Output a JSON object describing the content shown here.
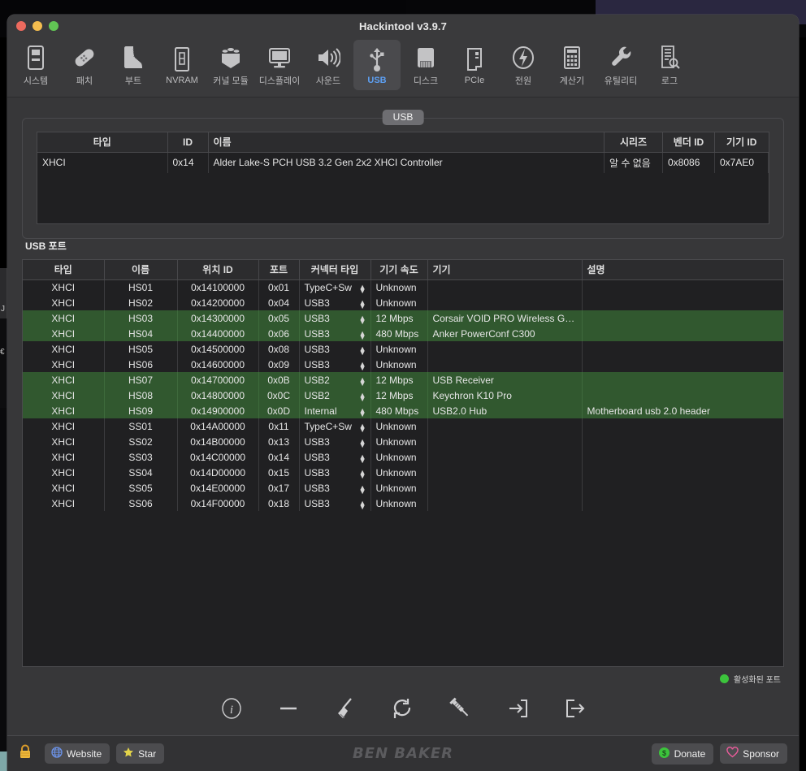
{
  "window": {
    "title": "Hackintool v3.9.7",
    "traffic_lights": [
      "close",
      "minimize",
      "zoom"
    ]
  },
  "toolbar": {
    "items": [
      {
        "label": "시스템",
        "icon": "computer-icon",
        "active": false
      },
      {
        "label": "패치",
        "icon": "bandage-icon",
        "active": false
      },
      {
        "label": "부트",
        "icon": "boot-icon",
        "active": false
      },
      {
        "label": "NVRAM",
        "icon": "memory-icon",
        "active": false
      },
      {
        "label": "커널 모듈",
        "icon": "kext-box-icon",
        "active": false
      },
      {
        "label": "디스플레이",
        "icon": "display-icon",
        "active": false
      },
      {
        "label": "사운드",
        "icon": "speaker-icon",
        "active": false
      },
      {
        "label": "USB",
        "icon": "usb-icon",
        "active": true
      },
      {
        "label": "디스크",
        "icon": "disk-icon",
        "active": false
      },
      {
        "label": "PCIe",
        "icon": "pcie-card-icon",
        "active": false
      },
      {
        "label": "전원",
        "icon": "power-bolt-icon",
        "active": false
      },
      {
        "label": "계산기",
        "icon": "calculator-icon",
        "active": false
      },
      {
        "label": "유틸리티",
        "icon": "wrench-icon",
        "active": false
      },
      {
        "label": "로그",
        "icon": "log-search-icon",
        "active": false
      }
    ]
  },
  "usb_group": {
    "tab_label": "USB",
    "controller_table": {
      "columns": [
        "타입",
        "ID",
        "이름",
        "시리즈",
        "벤더 ID",
        "기기 ID"
      ],
      "rows": [
        {
          "type": "XHCI",
          "id": "0x14",
          "name": "Alder Lake-S PCH USB 3.2 Gen 2x2 XHCI Controller",
          "series": "알 수 없음",
          "vendor_id": "0x8086",
          "device_id": "0x7AE0"
        }
      ]
    }
  },
  "ports_section": {
    "label": "USB 포트",
    "columns": [
      "타입",
      "이름",
      "위치 ID",
      "포트",
      "커넥터 타입",
      "기기 속도",
      "기기",
      "설명"
    ],
    "rows": [
      {
        "type": "XHCI",
        "name": "HS01",
        "location_id": "0x14100000",
        "port": "0x01",
        "connector": "TypeC+Sw",
        "speed": "Unknown",
        "device": "",
        "comment": "",
        "active": false
      },
      {
        "type": "XHCI",
        "name": "HS02",
        "location_id": "0x14200000",
        "port": "0x04",
        "connector": "USB3",
        "speed": "Unknown",
        "device": "",
        "comment": "",
        "active": false
      },
      {
        "type": "XHCI",
        "name": "HS03",
        "location_id": "0x14300000",
        "port": "0x05",
        "connector": "USB3",
        "speed": "12 Mbps",
        "device": "Corsair VOID PRO Wireless Ga…",
        "comment": "",
        "active": true
      },
      {
        "type": "XHCI",
        "name": "HS04",
        "location_id": "0x14400000",
        "port": "0x06",
        "connector": "USB3",
        "speed": "480 Mbps",
        "device": "Anker PowerConf C300",
        "comment": "",
        "active": true
      },
      {
        "type": "XHCI",
        "name": "HS05",
        "location_id": "0x14500000",
        "port": "0x08",
        "connector": "USB3",
        "speed": "Unknown",
        "device": "",
        "comment": "",
        "active": false
      },
      {
        "type": "XHCI",
        "name": "HS06",
        "location_id": "0x14600000",
        "port": "0x09",
        "connector": "USB3",
        "speed": "Unknown",
        "device": "",
        "comment": "",
        "active": false
      },
      {
        "type": "XHCI",
        "name": "HS07",
        "location_id": "0x14700000",
        "port": "0x0B",
        "connector": "USB2",
        "speed": "12 Mbps",
        "device": "USB Receiver",
        "comment": "",
        "active": true
      },
      {
        "type": "XHCI",
        "name": "HS08",
        "location_id": "0x14800000",
        "port": "0x0C",
        "connector": "USB2",
        "speed": "12 Mbps",
        "device": "Keychron K10 Pro",
        "comment": "",
        "active": true
      },
      {
        "type": "XHCI",
        "name": "HS09",
        "location_id": "0x14900000",
        "port": "0x0D",
        "connector": "Internal",
        "speed": "480 Mbps",
        "device": "USB2.0 Hub",
        "comment": "Motherboard usb 2.0 header",
        "active": true
      },
      {
        "type": "XHCI",
        "name": "SS01",
        "location_id": "0x14A00000",
        "port": "0x11",
        "connector": "TypeC+Sw",
        "speed": "Unknown",
        "device": "",
        "comment": "",
        "active": false
      },
      {
        "type": "XHCI",
        "name": "SS02",
        "location_id": "0x14B00000",
        "port": "0x13",
        "connector": "USB3",
        "speed": "Unknown",
        "device": "",
        "comment": "",
        "active": false
      },
      {
        "type": "XHCI",
        "name": "SS03",
        "location_id": "0x14C00000",
        "port": "0x14",
        "connector": "USB3",
        "speed": "Unknown",
        "device": "",
        "comment": "",
        "active": false
      },
      {
        "type": "XHCI",
        "name": "SS04",
        "location_id": "0x14D00000",
        "port": "0x15",
        "connector": "USB3",
        "speed": "Unknown",
        "device": "",
        "comment": "",
        "active": false
      },
      {
        "type": "XHCI",
        "name": "SS05",
        "location_id": "0x14E00000",
        "port": "0x17",
        "connector": "USB3",
        "speed": "Unknown",
        "device": "",
        "comment": "",
        "active": false
      },
      {
        "type": "XHCI",
        "name": "SS06",
        "location_id": "0x14F00000",
        "port": "0x18",
        "connector": "USB3",
        "speed": "Unknown",
        "device": "",
        "comment": "",
        "active": false
      }
    ],
    "legend": {
      "label": "활성화된 포트",
      "color": "#3cc43c"
    }
  },
  "actions": [
    {
      "icon": "info-circle-icon"
    },
    {
      "icon": "minus-icon"
    },
    {
      "icon": "broom-icon"
    },
    {
      "icon": "refresh-icon"
    },
    {
      "icon": "syringe-icon"
    },
    {
      "icon": "import-icon"
    },
    {
      "icon": "export-icon"
    }
  ],
  "footer": {
    "lock_icon": "lock-icon",
    "website_label": "Website",
    "star_label": "Star",
    "brand": "BEN BAKER",
    "donate_label": "Donate",
    "sponsor_label": "Sponsor"
  },
  "colors": {
    "accent": "#5d9ff2",
    "active_row": "#31582f",
    "legend_green": "#3cc43c",
    "donate_green": "#3cc43c",
    "sponsor_pink": "#ec5c9c",
    "star_yellow": "#e3d44a"
  }
}
